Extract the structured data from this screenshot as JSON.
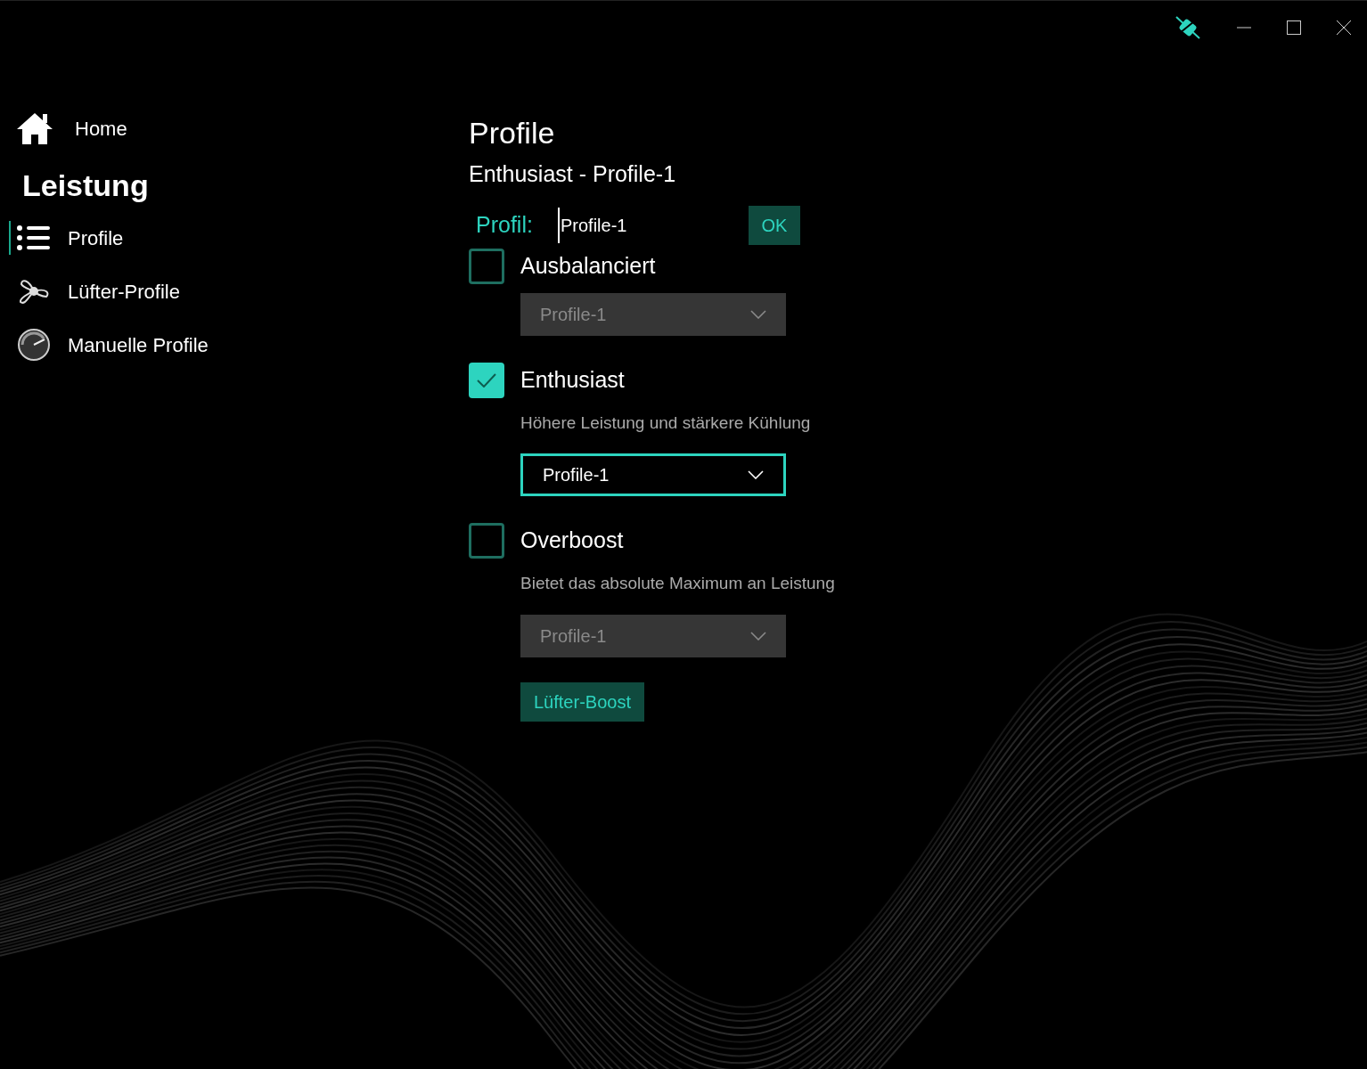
{
  "sidebar": {
    "home": {
      "label": "Home"
    },
    "section": "Leistung",
    "items": [
      {
        "label": "Profile",
        "selected": true
      },
      {
        "label": "Lüfter-Profile",
        "selected": false
      },
      {
        "label": "Manuelle Profile",
        "selected": false
      }
    ]
  },
  "main": {
    "title": "Profile",
    "subtitle": "Enthusiast - Profile-1",
    "profile_field": {
      "label": "Profil:",
      "value": "Profile-1",
      "button": "OK"
    },
    "modes": [
      {
        "label": "Ausbalanciert",
        "checked": false,
        "dropdown": {
          "value": "Profile-1",
          "disabled": true
        }
      },
      {
        "label": "Enthusiast",
        "checked": true,
        "description": "Höhere Leistung und stärkere Kühlung",
        "dropdown": {
          "value": "Profile-1",
          "disabled": false
        }
      },
      {
        "label": "Overboost",
        "checked": false,
        "description": "Bietet das absolute Maximum an Leistung",
        "dropdown": {
          "value": "Profile-1",
          "disabled": true
        }
      }
    ],
    "fan_boost_button": "Lüfter-Boost"
  }
}
